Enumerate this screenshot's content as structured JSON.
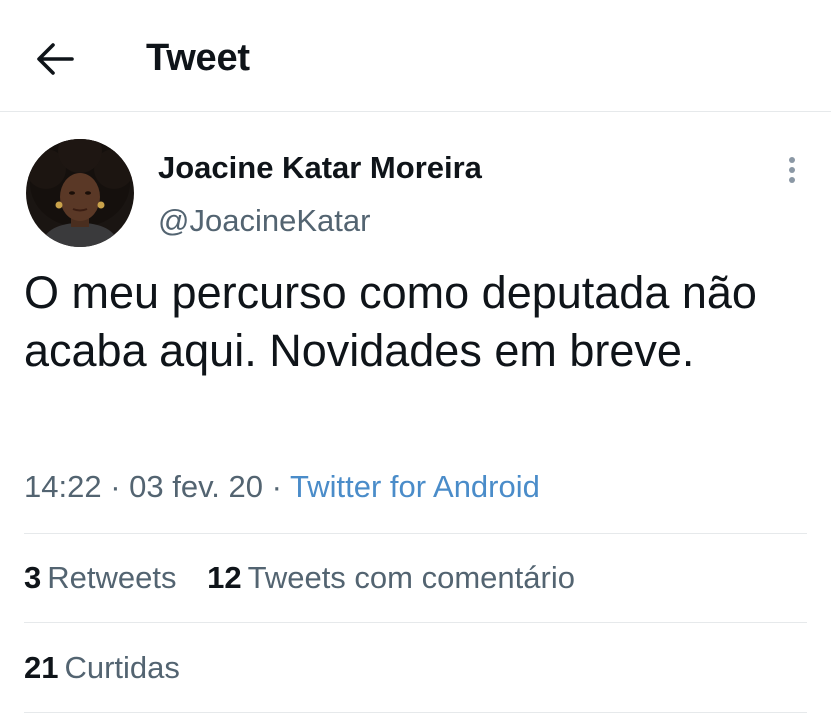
{
  "header": {
    "title": "Tweet",
    "back_icon": "arrow-left-icon"
  },
  "tweet": {
    "author": {
      "display_name": "Joacine Katar Moreira",
      "handle": "@JoacineKatar"
    },
    "text": "O meu percurso como deputada não acaba aqui. Novidades em breve.",
    "time": "14:22",
    "separator": "·",
    "date": "03 fev. 20",
    "source": "Twitter for Android"
  },
  "stats": {
    "retweets_count": "3",
    "retweets_label": "Retweets",
    "quotes_count": "12",
    "quotes_label": "Tweets com comentário",
    "likes_count": "21",
    "likes_label": "Curtidas"
  },
  "colors": {
    "text_primary": "#0f1419",
    "text_secondary": "#536471",
    "link": "#4a8cc9",
    "divider": "#e6e9eb"
  }
}
